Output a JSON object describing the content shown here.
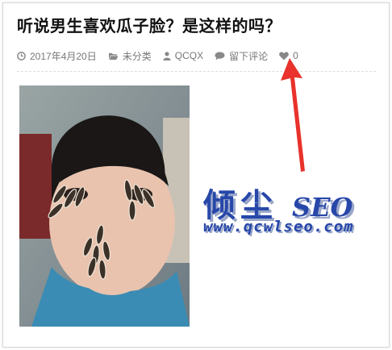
{
  "post": {
    "title": "听说男生喜欢瓜子脸？是这样的吗？",
    "meta": {
      "date": "2017年4月20日",
      "category": "未分类",
      "author": "QCQX",
      "comments": "留下评论",
      "likes": "0"
    }
  },
  "watermark": {
    "brand_cn": "倾尘",
    "brand_seo": "SEO",
    "url": "www.qcwlseo.com"
  },
  "colors": {
    "watermark_blue": "#2747a9",
    "arrow_red": "#e8322b",
    "meta_text": "#777777"
  },
  "icons": [
    "clock-icon",
    "folder-icon",
    "user-icon",
    "comment-icon",
    "heart-icon",
    "arrow-icon"
  ]
}
